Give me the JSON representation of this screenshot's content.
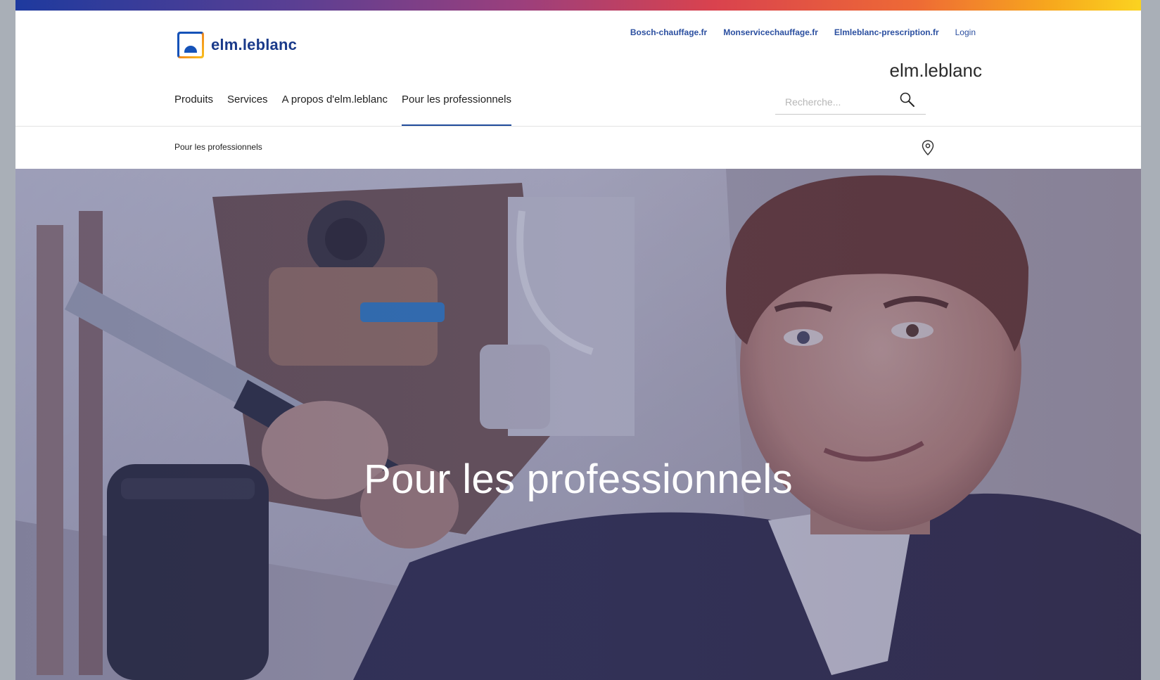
{
  "brand": {
    "logo_text": "elm.leblanc",
    "right_brand": "elm.leblanc"
  },
  "util_links": [
    {
      "label": "Bosch-chauffage.fr"
    },
    {
      "label": "Monservicechauffage.fr"
    },
    {
      "label": "Elmleblanc-prescription.fr"
    },
    {
      "label": "Login"
    }
  ],
  "nav": {
    "items": [
      {
        "label": "Produits"
      },
      {
        "label": "Services"
      },
      {
        "label": "A propos d'elm.leblanc"
      },
      {
        "label": "Pour les professionnels",
        "active": true
      }
    ]
  },
  "search": {
    "placeholder": "Recherche...",
    "icon": "search-icon"
  },
  "breadcrumb": {
    "current": "Pour les professionnels",
    "location_icon": "location-pin-icon"
  },
  "hero": {
    "title": "Pour les professionnels"
  },
  "colors": {
    "accent": "#1f4b9b",
    "link": "#2b4fa0"
  }
}
